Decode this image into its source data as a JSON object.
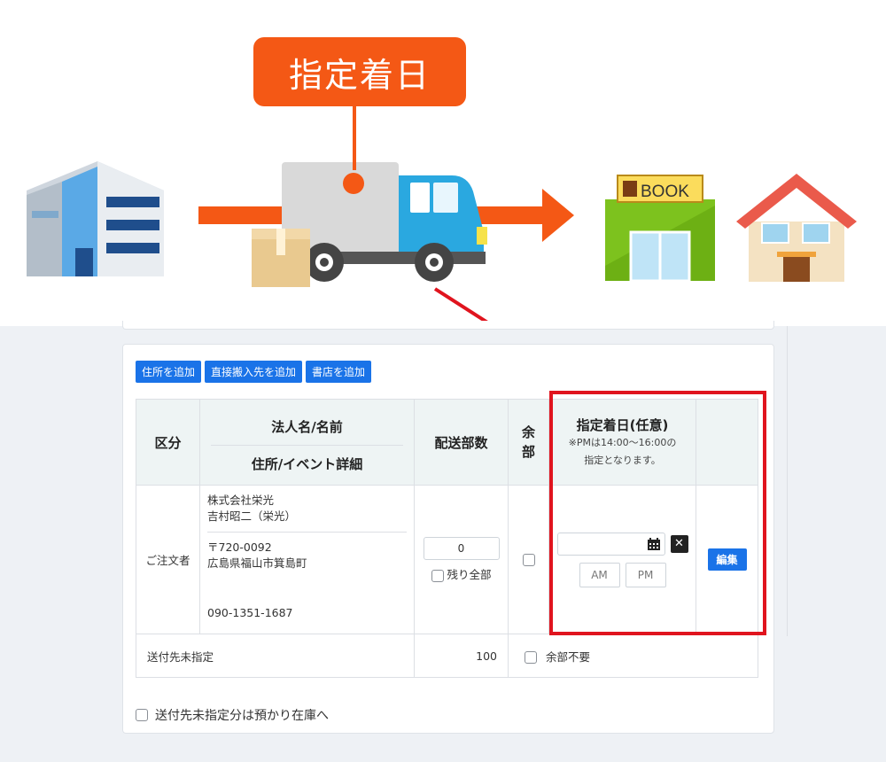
{
  "illustration": {
    "callout_label": "指定着日",
    "store_sign": "BOOK",
    "colors": {
      "accent": "#f45815",
      "highlight": "#e0141e"
    }
  },
  "toolbar": {
    "buttons": [
      "住所を追加",
      "直接搬入先を追加",
      "書店を追加"
    ]
  },
  "table": {
    "headers": {
      "category": "区分",
      "name": "法人名/名前",
      "address": "住所/イベント詳細",
      "quantity": "配送部数",
      "surplus": "余部",
      "date": "指定着日(任意)",
      "date_note1": "※PMは14:00〜16:00の",
      "date_note2": "指定となります。"
    },
    "orderer_row": {
      "category": "ご注文者",
      "company": "株式会社栄光",
      "person": "吉村昭二（栄光）",
      "postal": "〒720-0092",
      "address": "広島県福山市箕島町",
      "phone": "090-1351-1687",
      "quantity_value": "0",
      "remaining_all_label": "残り全部",
      "date_value": "",
      "am_label": "AM",
      "pm_label": "PM",
      "edit_label": "編集"
    },
    "unassigned_row": {
      "label": "送付先未指定",
      "quantity": "100",
      "surplus_label": "余部不要"
    }
  },
  "footer": {
    "stock_checkbox_label": "送付先未指定分は預かり在庫へ"
  }
}
